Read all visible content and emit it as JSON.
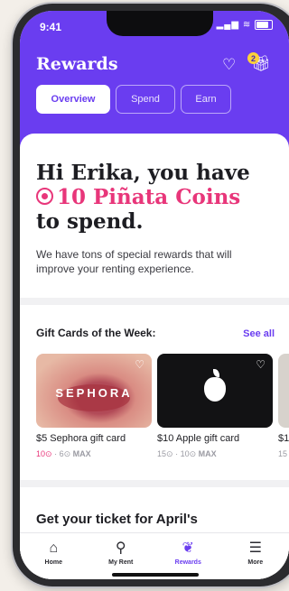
{
  "status": {
    "time": "9:41"
  },
  "header": {
    "title": "Rewards",
    "gift_badge": "2"
  },
  "tabs": [
    {
      "label": "Overview",
      "active": true
    },
    {
      "label": "Spend",
      "active": false
    },
    {
      "label": "Earn",
      "active": false
    }
  ],
  "hero": {
    "line1": "Hi Erika, you have",
    "coins": "10 Piñata Coins",
    "line3": "to spend.",
    "subtext": "We have tons of special rewards that will improve your renting experience."
  },
  "gift_cards": {
    "title": "Gift Cards of the Week:",
    "see_all": "See all",
    "items": [
      {
        "brand": "SEPHORA",
        "label": "$5 Sephora gift card",
        "coins": "10",
        "max": "6",
        "max_label": "MAX"
      },
      {
        "brand": "apple-logo",
        "label": "$10 Apple gift card",
        "coins": "15",
        "max": "10",
        "max_label": "MAX"
      },
      {
        "label": "$1",
        "coins": "15"
      }
    ]
  },
  "ticket": {
    "title": "Get your ticket for April's"
  },
  "nav": [
    {
      "label": "Home",
      "icon": "home-icon"
    },
    {
      "label": "My Rent",
      "icon": "rent-icon"
    },
    {
      "label": "Rewards",
      "icon": "rewards-icon",
      "active": true
    },
    {
      "label": "More",
      "icon": "menu-icon"
    }
  ],
  "colors": {
    "brand": "#6a3df0",
    "accent": "#e8367a"
  }
}
